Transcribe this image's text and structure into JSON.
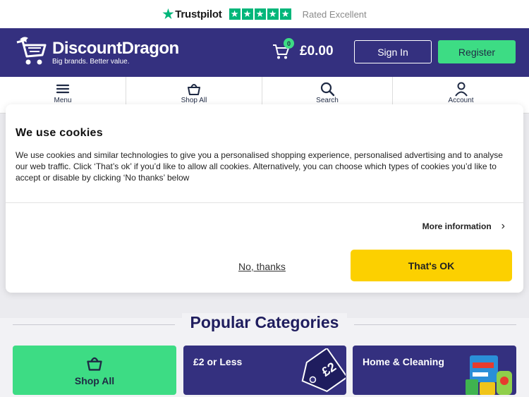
{
  "trustpilot": {
    "brand": "Trustpilot",
    "rating_text": "Rated Excellent",
    "stars": 5,
    "star_color": "#00b67a"
  },
  "header": {
    "brand_name": "DiscountDragon",
    "tagline": "Big brands. Better value.",
    "cart_count": "0",
    "cart_total": "£0.00",
    "signin_label": "Sign In",
    "register_label": "Register",
    "bg_color": "#34307f",
    "accent_color": "#3ddc84"
  },
  "nav": {
    "items": [
      {
        "label": "Menu",
        "icon": "hamburger-icon"
      },
      {
        "label": "Shop All",
        "icon": "basket-icon"
      },
      {
        "label": "Search",
        "icon": "search-icon"
      },
      {
        "label": "Account",
        "icon": "user-icon"
      }
    ]
  },
  "cookie": {
    "title": "We use cookies",
    "body": "We use cookies and similar technologies to give you a personalised shopping experience, personalised advertising and to analyse our web traffic. Click ‘That’s ok’ if you’d like to allow all cookies. Alternatively, you can choose which types of cookies you’d like to accept or disable by clicking ‘No thanks’ below",
    "more_info": "More information",
    "decline_label": "No, thanks",
    "accept_label": "That's OK",
    "accept_color": "#fcd000"
  },
  "popular": {
    "title": "Popular Categories",
    "cards": [
      {
        "label": "Shop All",
        "icon": "basket-icon"
      },
      {
        "label": "£2 or Less",
        "tag_text": "£2"
      },
      {
        "label": "Home & Cleaning"
      }
    ]
  }
}
